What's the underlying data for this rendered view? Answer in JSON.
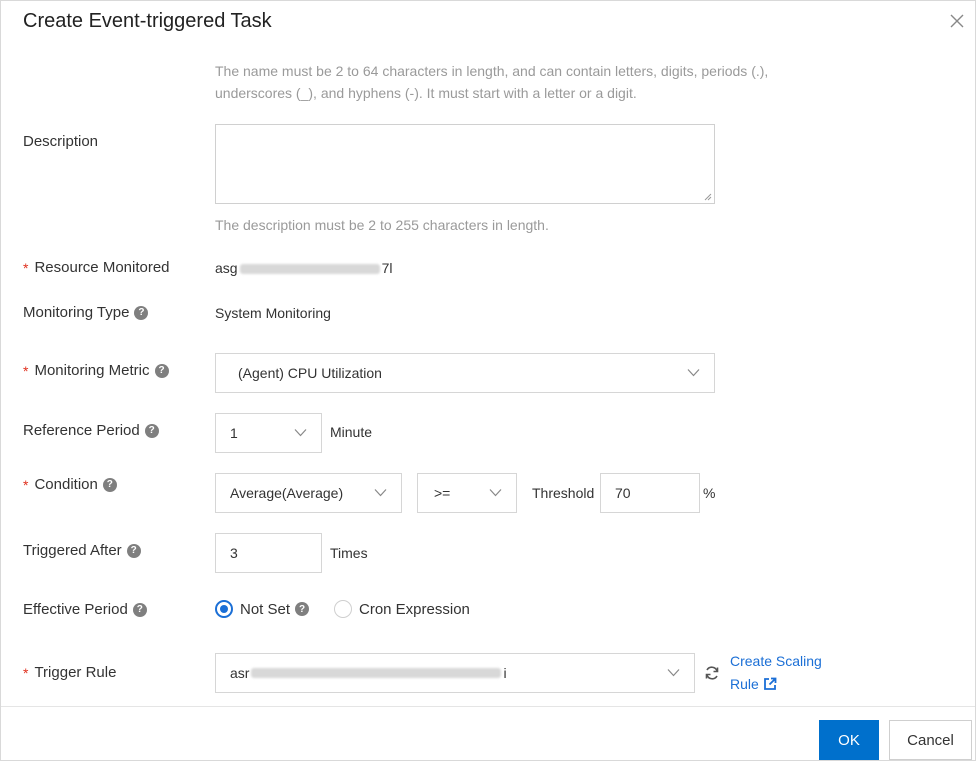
{
  "dialog": {
    "title": "Create Event-triggered Task"
  },
  "name_hint": {
    "line1": "The name must be 2 to 64 characters in length, and can contain letters, digits, periods (.),",
    "line2": "underscores (_), and hyphens (-). It must start with a letter or a digit."
  },
  "description": {
    "label": "Description",
    "value": "",
    "hint": "The description must be 2 to 255 characters in length."
  },
  "resource_monitored": {
    "label": "Resource Monitored",
    "value_prefix": "asg",
    "value_suffix": "7l"
  },
  "monitoring_type": {
    "label": "Monitoring Type",
    "value": "System Monitoring"
  },
  "monitoring_metric": {
    "label": "Monitoring Metric",
    "value": "(Agent)  CPU Utilization"
  },
  "reference_period": {
    "label": "Reference Period",
    "value": "1",
    "unit": "Minute"
  },
  "condition": {
    "label": "Condition",
    "statistic": "Average(Average)",
    "operator": ">=",
    "threshold_label": "Threshold",
    "threshold_value": "70",
    "unit": "%"
  },
  "triggered_after": {
    "label": "Triggered After",
    "value": "3",
    "unit": "Times"
  },
  "effective_period": {
    "label": "Effective Period",
    "options": [
      "Not Set",
      "Cron Expression"
    ],
    "selected": "Not Set"
  },
  "trigger_rule": {
    "label": "Trigger Rule",
    "value_prefix": "asr",
    "value_suffix": "i",
    "link_line1": "Create Scaling",
    "link_line2": "Rule"
  },
  "footer": {
    "ok_label": "OK",
    "cancel_label": "Cancel"
  },
  "colors": {
    "primary": "#0070cc",
    "link": "#1b6fd6",
    "required": "#e0301e"
  }
}
